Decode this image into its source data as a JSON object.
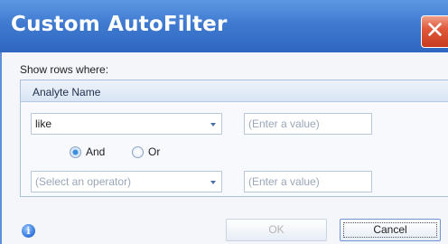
{
  "dialog": {
    "title": "Custom AutoFilter",
    "close_glyph": "✕"
  },
  "filter": {
    "instruction": "Show rows where:",
    "field_name": "Analyte Name",
    "condition1": {
      "operator": "like",
      "value_placeholder": "(Enter a value)"
    },
    "logic": {
      "and_label": "And",
      "or_label": "Or",
      "selected": "And"
    },
    "condition2": {
      "operator_placeholder": "(Select an operator)",
      "value_placeholder": "(Enter a value)"
    }
  },
  "footer": {
    "info_glyph": "i",
    "ok_label": "OK",
    "cancel_label": "Cancel"
  },
  "colors": {
    "title_bar": "#3f7ad0",
    "close_button": "#e05a3c",
    "radio_selected": "#3c8ce0"
  },
  "icons": {
    "close": "close-icon",
    "dropdown": "chevron-down-icon",
    "info": "info-icon"
  }
}
